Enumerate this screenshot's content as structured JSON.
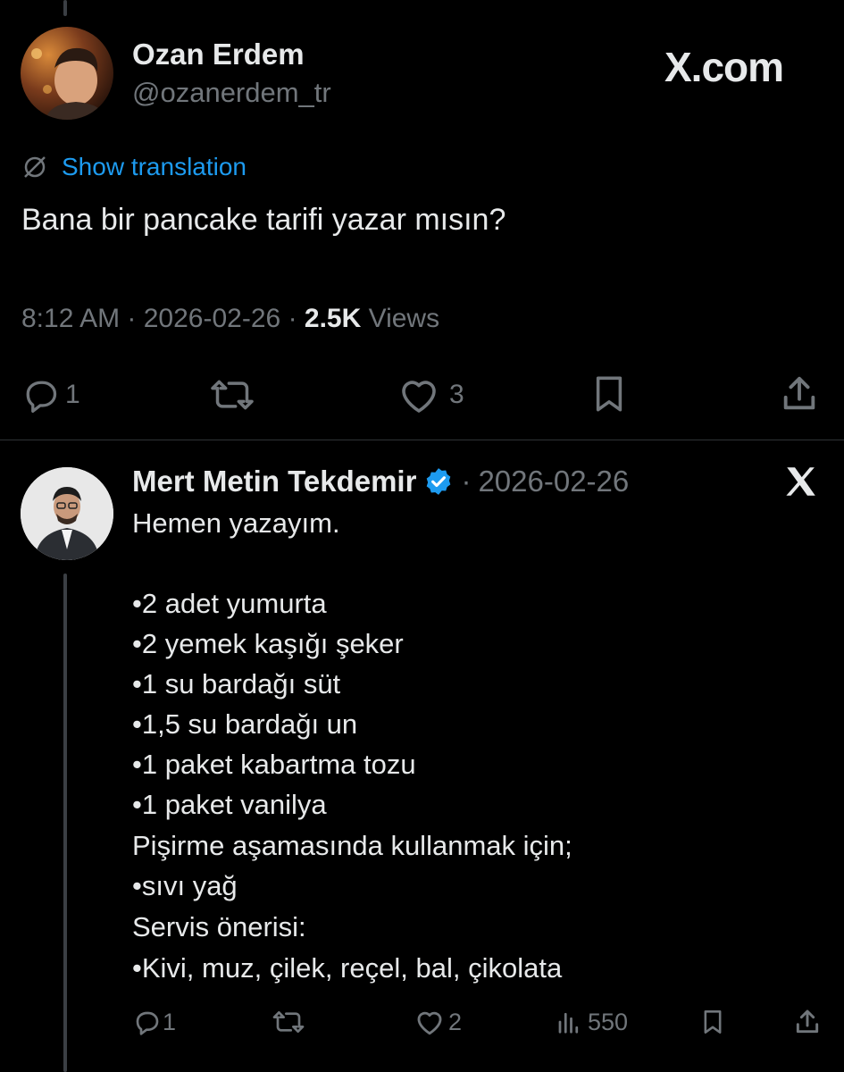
{
  "original": {
    "name": "Ozan Erdem",
    "handle": "@ozanerdem_tr",
    "site_label": "X.com",
    "show_translation": "Show translation",
    "text": "Bana bir pancake tarifi yazar mısın?",
    "time": "8:12 AM",
    "date": "2026-02-26",
    "views_count": "2.5K",
    "views_label": "Views",
    "replies": "1",
    "likes": "3"
  },
  "reply": {
    "name": "Mert Metin Tekdemir",
    "date": "2026-02-26",
    "lines": [
      "Hemen yazayım.",
      "",
      "•2 adet yumurta",
      "•2 yemek kaşığı şeker",
      "•1 su bardağı süt",
      "•1,5 su bardağı un",
      "•1 paket kabartma tozu",
      "•1 paket vanilya",
      "Pişirme aşamasında kullanmak için;",
      "•sıvı yağ",
      "Servis önerisi:",
      "•Kivi, muz, çilek, reçel, bal, çikolata"
    ],
    "replies": "1",
    "likes": "2",
    "views": "550"
  },
  "colors": {
    "background": "#000000",
    "text": "#e7e9ea",
    "muted": "#71767b",
    "link": "#1d9bf0",
    "verified": "#1d9bf0"
  }
}
